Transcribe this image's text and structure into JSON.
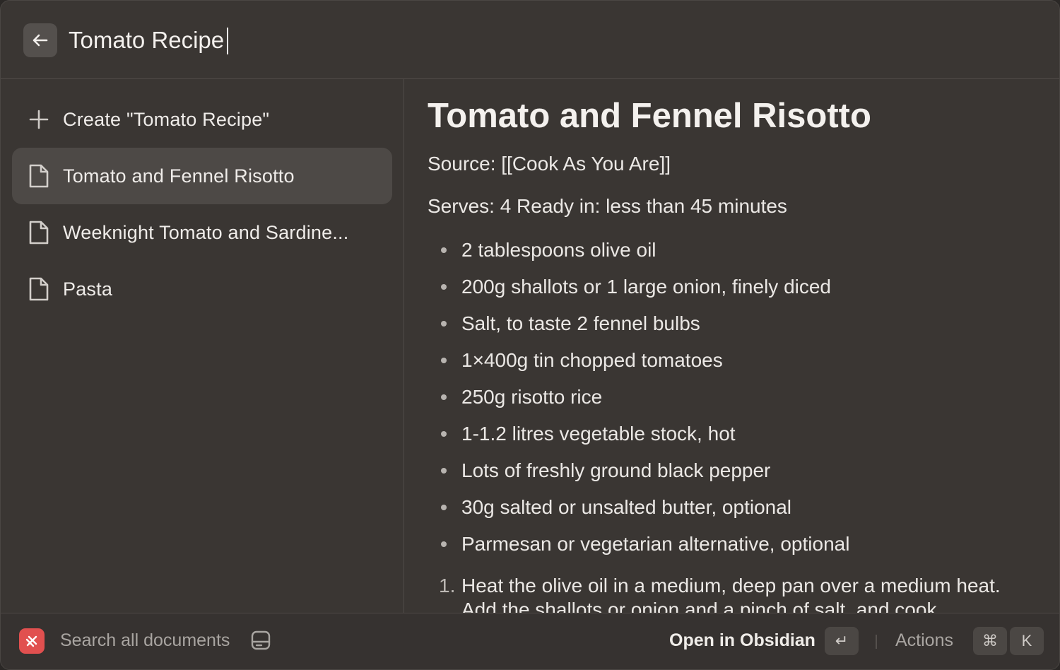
{
  "search": {
    "value": "Tomato Recipe"
  },
  "sidebar": {
    "items": [
      {
        "label": "Create \"Tomato Recipe\"",
        "icon": "plus-icon"
      },
      {
        "label": "Tomato and Fennel Risotto",
        "icon": "document-icon",
        "selected": true
      },
      {
        "label": "Weeknight Tomato and Sardine...",
        "icon": "document-icon"
      },
      {
        "label": "Pasta",
        "icon": "document-icon"
      }
    ]
  },
  "detail": {
    "title": "Tomato and Fennel Risotto",
    "source": "Source: [[Cook As You Are]]",
    "serves": "Serves: 4 Ready in: less than 45 minutes",
    "ingredients": [
      "2 tablespoons olive oil",
      "200g shallots or 1 large onion, finely diced",
      "Salt, to taste 2 fennel bulbs",
      "1×400g tin chopped tomatoes",
      "250g risotto rice",
      "1-1.2 litres vegetable stock, hot",
      "Lots of freshly ground black pepper",
      "30g salted or unsalted butter, optional",
      "Parmesan or vegetarian alternative, optional"
    ],
    "steps": [
      {
        "num": "1.",
        "text": "Heat the olive oil in a medium, deep pan over a medium heat. Add the shallots or onion and a pinch of salt, and cook"
      }
    ]
  },
  "footer": {
    "search_label": "Search all documents",
    "primary_action": "Open in Obsidian",
    "enter_key": "↵",
    "actions_label": "Actions",
    "cmd_key": "⌘",
    "k_key": "K"
  },
  "colors": {
    "app_accent": "#e1504f",
    "background": "#3a3633"
  }
}
